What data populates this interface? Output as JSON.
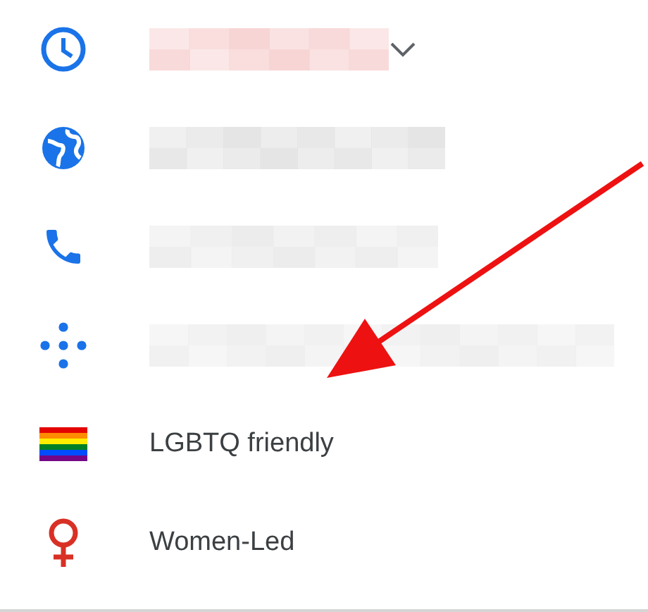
{
  "rows": [
    {
      "kind": "hours",
      "dropdown": true
    },
    {
      "kind": "website"
    },
    {
      "kind": "phone"
    },
    {
      "kind": "plus-code"
    },
    {
      "kind": "lgbtq",
      "label": "LGBTQ friendly"
    },
    {
      "kind": "women-led",
      "label": "Women-Led"
    }
  ],
  "annotation": {
    "kind": "arrow"
  }
}
